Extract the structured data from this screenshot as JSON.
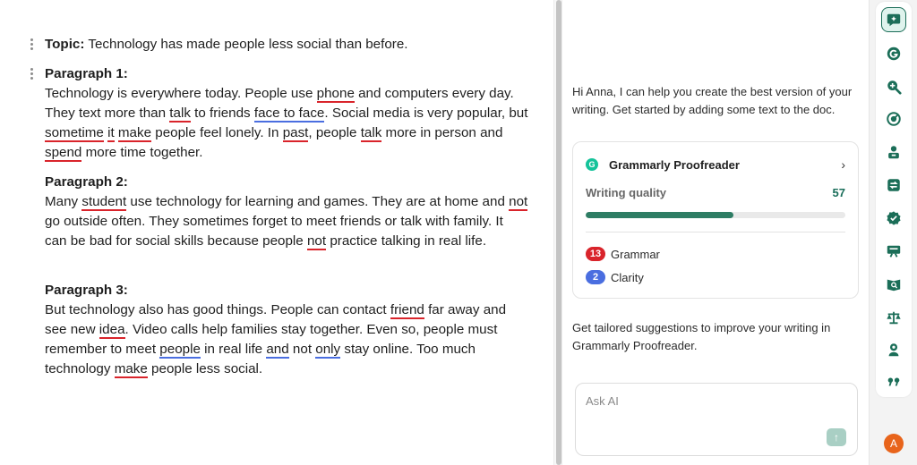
{
  "document": {
    "topic_label": "Topic:",
    "topic_text": " Technology has made people less social than before.",
    "paragraphs": [
      {
        "heading": "Paragraph 1:",
        "segments": [
          {
            "t": "Technology is everywhere today. People use "
          },
          {
            "t": "phone",
            "u": "red"
          },
          {
            "t": " and computers every day. They text more than "
          },
          {
            "t": "talk",
            "u": "red"
          },
          {
            "t": " to friends "
          },
          {
            "t": "face to face",
            "u": "blue"
          },
          {
            "t": ". Social media is very popular, but "
          },
          {
            "t": "sometime",
            "u": "red"
          },
          {
            "t": " "
          },
          {
            "t": "it",
            "u": "red"
          },
          {
            "t": " "
          },
          {
            "t": "make",
            "u": "red"
          },
          {
            "t": " people feel lonely. In "
          },
          {
            "t": "past",
            "u": "red"
          },
          {
            "t": ", people "
          },
          {
            "t": "talk",
            "u": "red"
          },
          {
            "t": " more in person and "
          },
          {
            "t": "spend",
            "u": "red"
          },
          {
            "t": " more time together."
          }
        ]
      },
      {
        "heading": "Paragraph 2:",
        "segments": [
          {
            "t": "Many "
          },
          {
            "t": "student",
            "u": "red"
          },
          {
            "t": " use technology for learning and games. They are at home and "
          },
          {
            "t": "not",
            "u": "red"
          },
          {
            "t": " go outside often. They sometimes forget to meet friends or talk with family. It can be bad for social skills because people "
          },
          {
            "t": "not",
            "u": "red"
          },
          {
            "t": " practice talking in real life."
          }
        ]
      },
      {
        "heading": "Paragraph 3:",
        "segments": [
          {
            "t": "But technology also has good things. People can contact "
          },
          {
            "t": "friend",
            "u": "red"
          },
          {
            "t": " far away and see new "
          },
          {
            "t": "idea",
            "u": "red"
          },
          {
            "t": ". Video calls help families stay together. Even so, people must remember to meet "
          },
          {
            "t": "people",
            "u": "blue"
          },
          {
            "t": " in real life "
          },
          {
            "t": "and",
            "u": "blue"
          },
          {
            "t": " not "
          },
          {
            "t": "only",
            "u": "blue"
          },
          {
            "t": " stay online. Too much technology "
          },
          {
            "t": "make",
            "u": "red"
          },
          {
            "t": " people less social."
          }
        ]
      }
    ]
  },
  "panel": {
    "greeting": "Hi Anna, I can help you create the best version of your writing. Get started by adding some text to the doc.",
    "card": {
      "title": "Grammarly Proofreader",
      "quality_label": "Writing quality",
      "quality_score": "57",
      "quality_fraction": 0.57,
      "issues": [
        {
          "count": "13",
          "label": "Grammar",
          "color": "#d9242b"
        },
        {
          "count": "2",
          "label": "Clarity",
          "color": "#4a6ee0"
        }
      ]
    },
    "tailored": "Get tailored suggestions to improve your writing in Grammarly Proofreader.",
    "ask_placeholder": "Ask AI"
  },
  "rail": {
    "icons": [
      "assistant-icon",
      "grammarly-icon",
      "zoom-in-icon",
      "target-icon",
      "user-icon",
      "switch-icon",
      "badge-check-icon",
      "presentation-icon",
      "book-search-icon",
      "scale-icon",
      "location-user-icon",
      "quote-icon"
    ],
    "avatar_initial": "A"
  },
  "colors": {
    "brand": "#15c39a",
    "accent": "#1b6e58",
    "error_red": "#d9242b",
    "error_blue": "#4a6ee0",
    "avatar": "#e8641b"
  }
}
